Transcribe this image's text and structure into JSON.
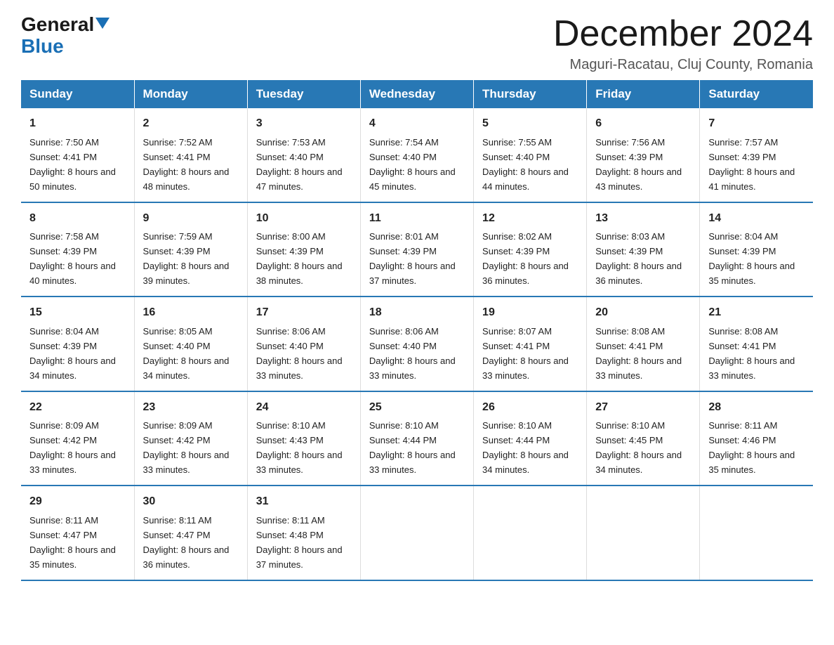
{
  "header": {
    "logo_general": "General",
    "logo_blue": "Blue",
    "month_title": "December 2024",
    "location": "Maguri-Racatau, Cluj County, Romania"
  },
  "weekdays": [
    "Sunday",
    "Monday",
    "Tuesday",
    "Wednesday",
    "Thursday",
    "Friday",
    "Saturday"
  ],
  "weeks": [
    [
      {
        "day": "1",
        "sunrise": "7:50 AM",
        "sunset": "4:41 PM",
        "daylight": "8 hours and 50 minutes."
      },
      {
        "day": "2",
        "sunrise": "7:52 AM",
        "sunset": "4:41 PM",
        "daylight": "8 hours and 48 minutes."
      },
      {
        "day": "3",
        "sunrise": "7:53 AM",
        "sunset": "4:40 PM",
        "daylight": "8 hours and 47 minutes."
      },
      {
        "day": "4",
        "sunrise": "7:54 AM",
        "sunset": "4:40 PM",
        "daylight": "8 hours and 45 minutes."
      },
      {
        "day": "5",
        "sunrise": "7:55 AM",
        "sunset": "4:40 PM",
        "daylight": "8 hours and 44 minutes."
      },
      {
        "day": "6",
        "sunrise": "7:56 AM",
        "sunset": "4:39 PM",
        "daylight": "8 hours and 43 minutes."
      },
      {
        "day": "7",
        "sunrise": "7:57 AM",
        "sunset": "4:39 PM",
        "daylight": "8 hours and 41 minutes."
      }
    ],
    [
      {
        "day": "8",
        "sunrise": "7:58 AM",
        "sunset": "4:39 PM",
        "daylight": "8 hours and 40 minutes."
      },
      {
        "day": "9",
        "sunrise": "7:59 AM",
        "sunset": "4:39 PM",
        "daylight": "8 hours and 39 minutes."
      },
      {
        "day": "10",
        "sunrise": "8:00 AM",
        "sunset": "4:39 PM",
        "daylight": "8 hours and 38 minutes."
      },
      {
        "day": "11",
        "sunrise": "8:01 AM",
        "sunset": "4:39 PM",
        "daylight": "8 hours and 37 minutes."
      },
      {
        "day": "12",
        "sunrise": "8:02 AM",
        "sunset": "4:39 PM",
        "daylight": "8 hours and 36 minutes."
      },
      {
        "day": "13",
        "sunrise": "8:03 AM",
        "sunset": "4:39 PM",
        "daylight": "8 hours and 36 minutes."
      },
      {
        "day": "14",
        "sunrise": "8:04 AM",
        "sunset": "4:39 PM",
        "daylight": "8 hours and 35 minutes."
      }
    ],
    [
      {
        "day": "15",
        "sunrise": "8:04 AM",
        "sunset": "4:39 PM",
        "daylight": "8 hours and 34 minutes."
      },
      {
        "day": "16",
        "sunrise": "8:05 AM",
        "sunset": "4:40 PM",
        "daylight": "8 hours and 34 minutes."
      },
      {
        "day": "17",
        "sunrise": "8:06 AM",
        "sunset": "4:40 PM",
        "daylight": "8 hours and 33 minutes."
      },
      {
        "day": "18",
        "sunrise": "8:06 AM",
        "sunset": "4:40 PM",
        "daylight": "8 hours and 33 minutes."
      },
      {
        "day": "19",
        "sunrise": "8:07 AM",
        "sunset": "4:41 PM",
        "daylight": "8 hours and 33 minutes."
      },
      {
        "day": "20",
        "sunrise": "8:08 AM",
        "sunset": "4:41 PM",
        "daylight": "8 hours and 33 minutes."
      },
      {
        "day": "21",
        "sunrise": "8:08 AM",
        "sunset": "4:41 PM",
        "daylight": "8 hours and 33 minutes."
      }
    ],
    [
      {
        "day": "22",
        "sunrise": "8:09 AM",
        "sunset": "4:42 PM",
        "daylight": "8 hours and 33 minutes."
      },
      {
        "day": "23",
        "sunrise": "8:09 AM",
        "sunset": "4:42 PM",
        "daylight": "8 hours and 33 minutes."
      },
      {
        "day": "24",
        "sunrise": "8:10 AM",
        "sunset": "4:43 PM",
        "daylight": "8 hours and 33 minutes."
      },
      {
        "day": "25",
        "sunrise": "8:10 AM",
        "sunset": "4:44 PM",
        "daylight": "8 hours and 33 minutes."
      },
      {
        "day": "26",
        "sunrise": "8:10 AM",
        "sunset": "4:44 PM",
        "daylight": "8 hours and 34 minutes."
      },
      {
        "day": "27",
        "sunrise": "8:10 AM",
        "sunset": "4:45 PM",
        "daylight": "8 hours and 34 minutes."
      },
      {
        "day": "28",
        "sunrise": "8:11 AM",
        "sunset": "4:46 PM",
        "daylight": "8 hours and 35 minutes."
      }
    ],
    [
      {
        "day": "29",
        "sunrise": "8:11 AM",
        "sunset": "4:47 PM",
        "daylight": "8 hours and 35 minutes."
      },
      {
        "day": "30",
        "sunrise": "8:11 AM",
        "sunset": "4:47 PM",
        "daylight": "8 hours and 36 minutes."
      },
      {
        "day": "31",
        "sunrise": "8:11 AM",
        "sunset": "4:48 PM",
        "daylight": "8 hours and 37 minutes."
      },
      null,
      null,
      null,
      null
    ]
  ]
}
